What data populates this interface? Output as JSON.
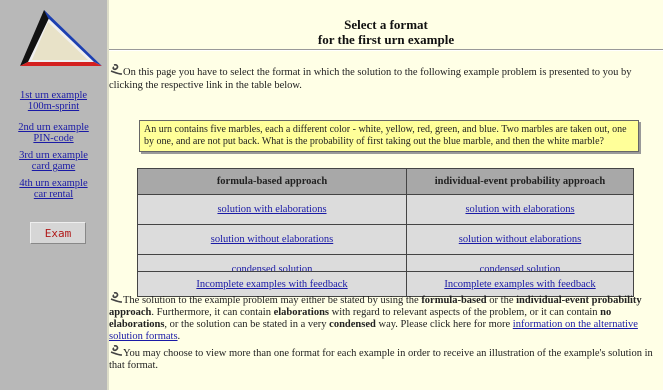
{
  "sidebar": {
    "links": [
      {
        "line1": "1st urn example",
        "line2": "100m-sprint"
      },
      {
        "line1": "2nd urn example",
        "line2": "PIN-code"
      },
      {
        "line1": "3rd urn example",
        "line2": "card game"
      },
      {
        "line1": "4th urn example",
        "line2": "car rental"
      }
    ],
    "exam_label": "Exam"
  },
  "header": {
    "title_line1": "Select a format",
    "title_line2": "for the first urn example"
  },
  "intro": "On this page you have to select the format in which the solution to the following example problem is presented to you by clicking the respective link in the table below.",
  "problem": "An urn contains five marbles, each a different color - white, yellow, red, green, and blue. Two marbles are taken out, one by one, and are not put back. What is the probability of first taking out the blue marble, and then the white marble?",
  "table": {
    "headers": [
      "formula-based approach",
      "individual-event probability approach"
    ],
    "rows": [
      [
        "solution with elaborations",
        "solution with elaborations"
      ],
      [
        "solution without elaborations",
        "solution without elaborations"
      ],
      [
        "condensed solution",
        "condensed solution"
      ]
    ],
    "incomplete": [
      "Incomplete examples with feedback",
      "Incomplete examples with feedback"
    ]
  },
  "para2": {
    "t1": "The solution to the example problem may either be stated by using the ",
    "b1": "formula-based",
    "t2": " or the ",
    "b2": "individual-event probability approach",
    "t3": ". Furthermore, it can contain ",
    "b3": "elaborations",
    "t4": " with regard to relevant aspects of the problem, or it can contain ",
    "b4": "no elaborations",
    "t5": ", or the solution can be stated in a very ",
    "b5": "condensed",
    "t6": " way. Please click here for more ",
    "link": "information on the alternative solution formats",
    "t7": "."
  },
  "para3": "You may choose to view more than one format for each example in order to receive an illustration of the example's solution in that format.",
  "icons": {
    "bullet": "bullet-scribble-icon",
    "logo": "triangle-logo-icon"
  },
  "colors": {
    "background": "#ffffe6",
    "sidebar": "#b8b8b8",
    "problem_box": "#ffff99",
    "exam_text": "#b01818",
    "link": "#1a1aa6"
  }
}
